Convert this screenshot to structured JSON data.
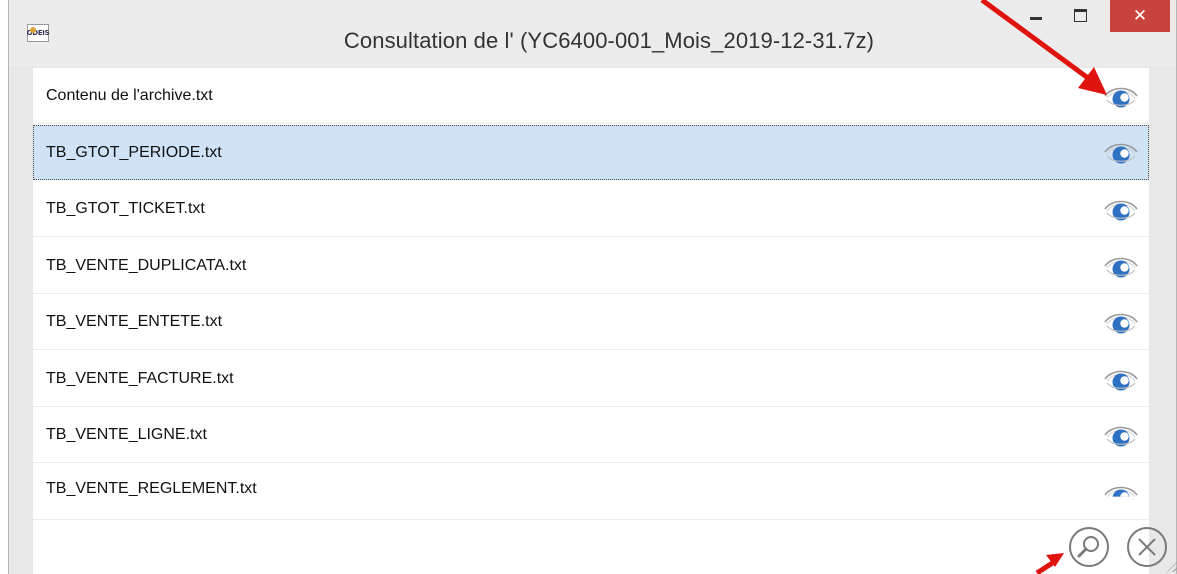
{
  "window": {
    "title": "Consultation de l' (YC6400-001_Mois_2019-12-31.7z)",
    "app_icon_text": "ODEIS",
    "close_label": "✕"
  },
  "files": [
    {
      "name": "Contenu de l'archive.txt",
      "selected": false
    },
    {
      "name": "TB_GTOT_PERIODE.txt",
      "selected": true
    },
    {
      "name": "TB_GTOT_TICKET.txt",
      "selected": false
    },
    {
      "name": "TB_VENTE_DUPLICATA.txt",
      "selected": false
    },
    {
      "name": "TB_VENTE_ENTETE.txt",
      "selected": false
    },
    {
      "name": "TB_VENTE_FACTURE.txt",
      "selected": false
    },
    {
      "name": "TB_VENTE_LIGNE.txt",
      "selected": false
    },
    {
      "name": "TB_VENTE_REGLEMENT.txt",
      "selected": false
    }
  ],
  "icons": {
    "view": "eye-icon",
    "search": "magnifier-icon",
    "close": "close-circle-icon"
  },
  "colors": {
    "selected_row": "#cfe2f6",
    "close_button": "#c7433c",
    "eye_iris": "#2f72c4",
    "annotation_arrow": "#e0140f"
  }
}
